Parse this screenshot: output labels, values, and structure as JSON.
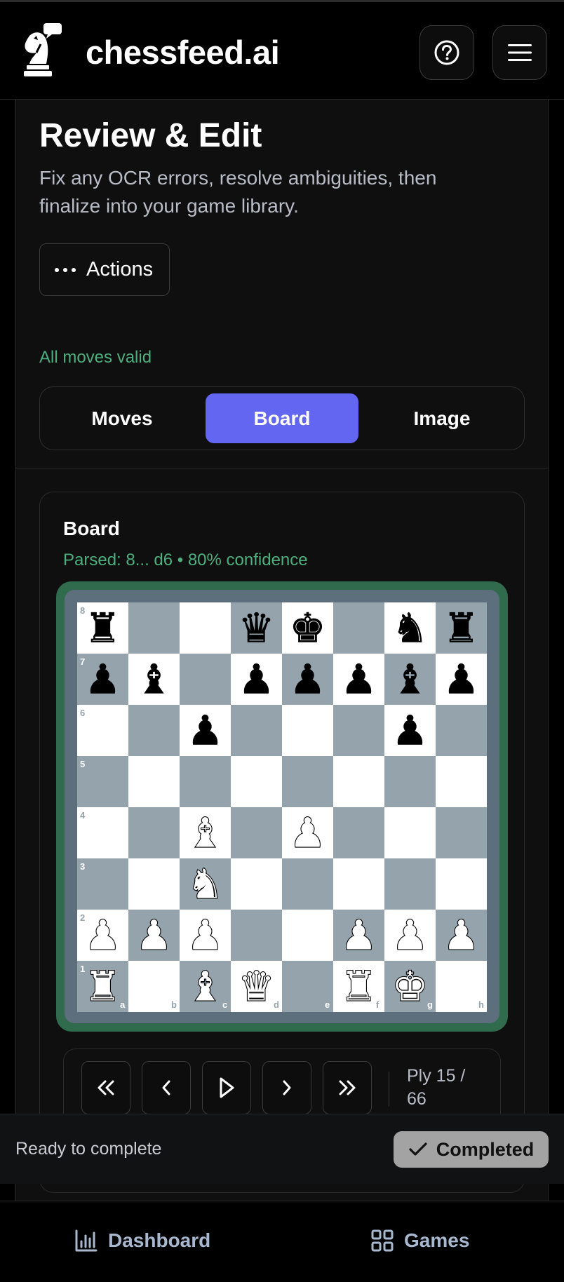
{
  "header": {
    "brand": "chessfeed.ai",
    "help_icon": "question-circle-icon",
    "menu_icon": "hamburger-menu-icon"
  },
  "page": {
    "title": "Review & Edit",
    "subtitle": "Fix any OCR errors, resolve ambiguities, then finalize into your game library.",
    "actions_label": "Actions",
    "validation_status": "All moves valid"
  },
  "tabs": [
    {
      "label": "Moves",
      "active": false
    },
    {
      "label": "Board",
      "active": true
    },
    {
      "label": "Image",
      "active": false
    }
  ],
  "board": {
    "title": "Board",
    "parsed": "Parsed: 8... d6 • 80% confidence",
    "rank_labels": [
      "8",
      "7",
      "6",
      "5",
      "4",
      "3",
      "2",
      "1"
    ],
    "file_labels": [
      "a",
      "b",
      "c",
      "d",
      "e",
      "f",
      "g",
      "h"
    ],
    "position": [
      [
        "r",
        "",
        "",
        "q",
        "k",
        "",
        "n",
        "r"
      ],
      [
        "p",
        "b",
        "",
        "p",
        "p",
        "p",
        "b",
        "p"
      ],
      [
        "",
        "",
        "p",
        "",
        "",
        "",
        "p",
        ""
      ],
      [
        "",
        "",
        "",
        "",
        "",
        "",
        "",
        ""
      ],
      [
        "",
        "",
        "B",
        "",
        "P",
        "",
        "",
        ""
      ],
      [
        "",
        "",
        "N",
        "",
        "",
        "",
        "",
        ""
      ],
      [
        "P",
        "P",
        "P",
        "",
        "",
        "P",
        "P",
        "P"
      ],
      [
        "R",
        "",
        "B",
        "Q",
        "",
        "R",
        "K",
        ""
      ]
    ]
  },
  "playback": {
    "first_icon": "double-chevron-left-icon",
    "prev_icon": "chevron-left-icon",
    "play_icon": "play-icon",
    "next_icon": "chevron-right-icon",
    "last_icon": "double-chevron-right-icon",
    "ply": "Ply 15 / 66"
  },
  "status": {
    "text": "Ready to complete",
    "button": "Completed"
  },
  "nav": {
    "dashboard": "Dashboard",
    "games": "Games"
  },
  "colors": {
    "accent": "#6366f1",
    "valid_green": "#4caf7d",
    "board_frame": "#2f6b4c",
    "dark_square": "#95a3ad",
    "light_square": "#ffffff"
  }
}
